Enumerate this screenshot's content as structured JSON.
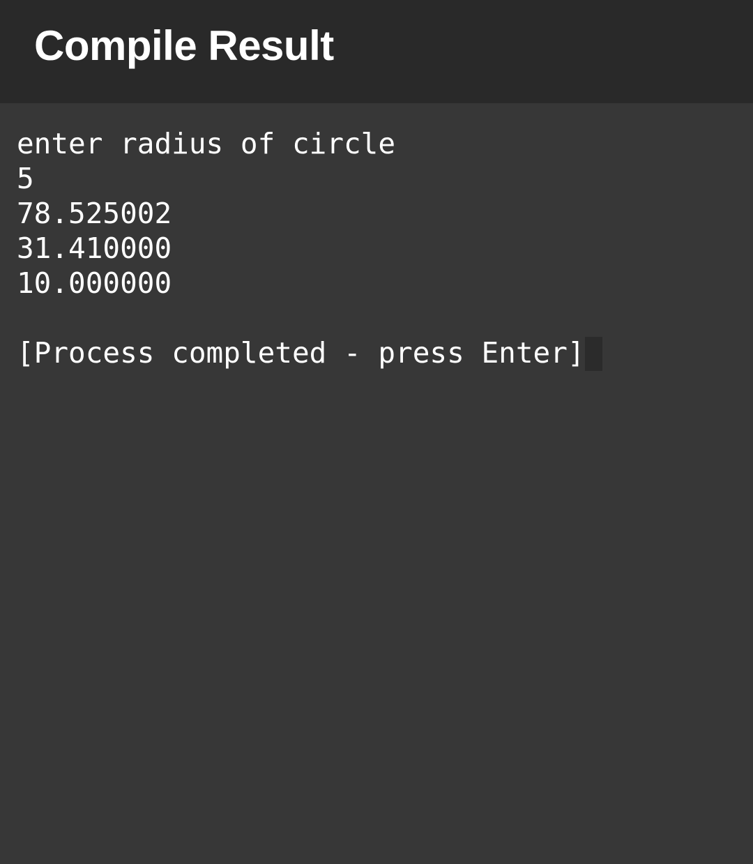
{
  "header": {
    "title": "Compile Result"
  },
  "terminal": {
    "lines": [
      "enter radius of circle",
      "5",
      "78.525002",
      "31.410000",
      "10.000000",
      "",
      "[Process completed - press Enter]"
    ]
  },
  "colors": {
    "header_background": "#292929",
    "content_background": "#373737",
    "text": "#ffffff",
    "cursor": "#2b2b2b"
  }
}
